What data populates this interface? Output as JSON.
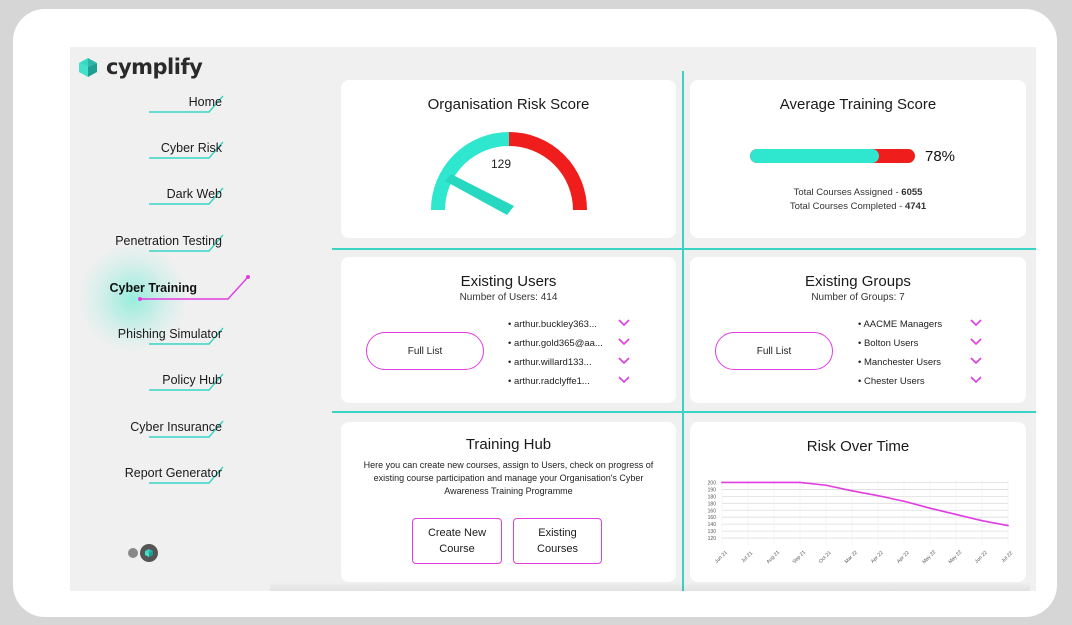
{
  "brand": {
    "name": "cymplify"
  },
  "sidebar": {
    "items": [
      {
        "label": "Home"
      },
      {
        "label": "Cyber Risk"
      },
      {
        "label": "Dark Web"
      },
      {
        "label": "Penetration Testing"
      },
      {
        "label": "Cyber Training",
        "active": true
      },
      {
        "label": "Phishing Simulator"
      },
      {
        "label": "Policy Hub"
      },
      {
        "label": "Cyber Insurance"
      },
      {
        "label": "Report Generator"
      }
    ]
  },
  "risk_score": {
    "title": "Organisation Risk Score",
    "value": "129"
  },
  "training_score": {
    "title": "Average Training Score",
    "percent": 78,
    "percent_label": "78%",
    "assigned_label": "Total Courses Assigned - ",
    "assigned_value": "6055",
    "completed_label": "Total Courses Completed - ",
    "completed_value": "4741"
  },
  "users": {
    "title": "Existing Users",
    "subtitle": "Number of Users: 414",
    "button": "Full List",
    "items": [
      "arthur.buckley363...",
      "arthur.gold365@aa...",
      "arthur.willard133...",
      "arthur.radclyffe1..."
    ]
  },
  "groups": {
    "title": "Existing Groups",
    "subtitle": "Number of Groups: 7",
    "button": "Full List",
    "items": [
      "AACME Managers",
      "Bolton Users",
      "Manchester Users",
      "Chester Users"
    ]
  },
  "training_hub": {
    "title": "Training Hub",
    "description": "Here you can create new courses, assign to Users, check on progress of existing course participation and manage your Organisation's Cyber Awareness Training Programme",
    "create_button": "Create New Course",
    "existing_button": "Existing Courses"
  },
  "risk_over_time": {
    "title": "Risk Over Time"
  },
  "chart_data": {
    "type": "line",
    "x": [
      "Jun 21",
      "Jul 21",
      "Aug 21",
      "Sep 21",
      "Oct 21",
      "Mar 22",
      "Apr 22",
      "Apr 22",
      "May 22",
      "May 22",
      "Jun 22",
      "Jul 22"
    ],
    "values": [
      200,
      200,
      200,
      200,
      196,
      188,
      181,
      173,
      163,
      154,
      145,
      138
    ],
    "ylim": [
      110,
      205
    ],
    "yticks": [
      120,
      130,
      140,
      150,
      160,
      170,
      180,
      190,
      200
    ],
    "ytick_labels": [
      "120",
      "130",
      "140",
      "160",
      "160",
      "180",
      "180",
      "190",
      "200"
    ],
    "color": "#e13ee1",
    "grid": true
  },
  "colors": {
    "accent": "#39d4c4",
    "pink": "#e13ee1",
    "red": "#f01d1d",
    "teal": "#2fe6cf"
  }
}
